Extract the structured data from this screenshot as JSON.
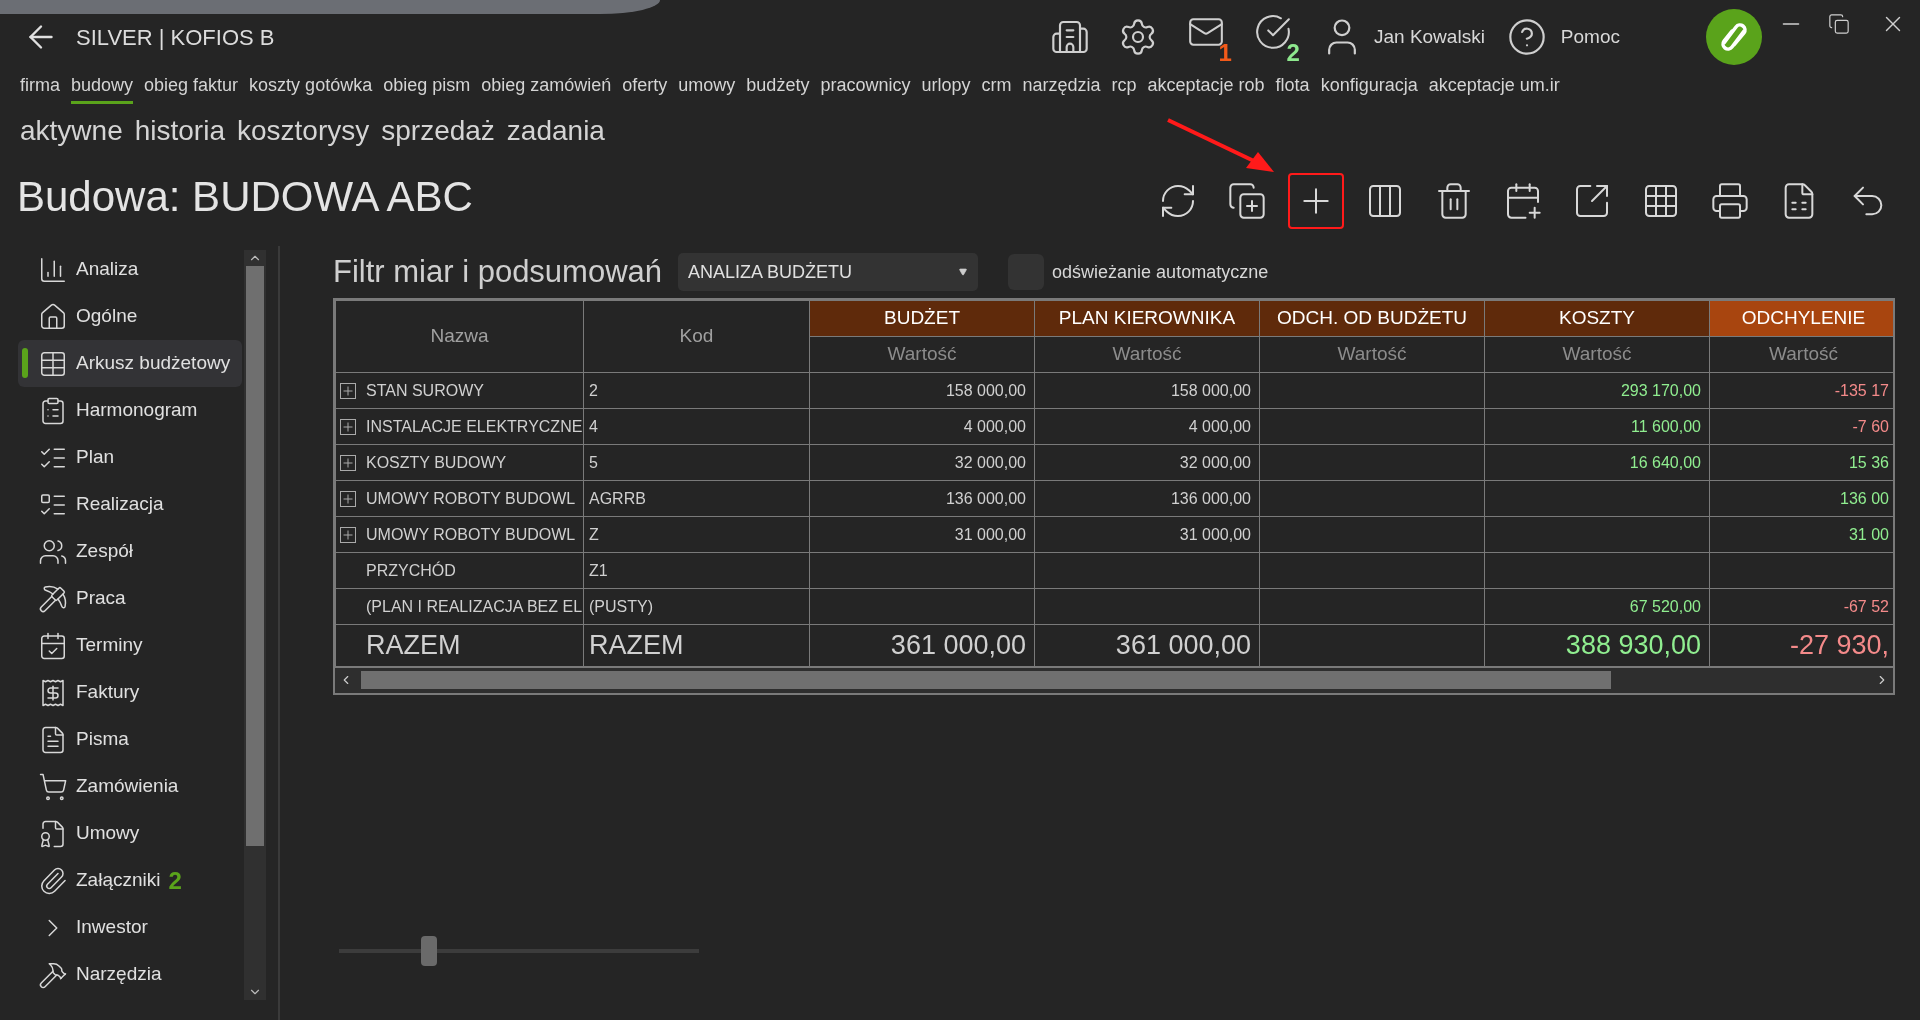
{
  "header": {
    "title": "SILVER | KOFIOS B",
    "mail_badge": {
      "text": "1",
      "color": "#f25a1a"
    },
    "tasks_badge": {
      "text": "2",
      "color": "#8ee88e"
    },
    "user": "Jan Kowalski",
    "help": "Pomoc"
  },
  "menu": [
    {
      "label": "firma",
      "selected": false
    },
    {
      "label": "budowy",
      "selected": true
    },
    {
      "label": "obieg faktur",
      "selected": false
    },
    {
      "label": "koszty gotówka",
      "selected": false
    },
    {
      "label": "obieg pism",
      "selected": false
    },
    {
      "label": "obieg zamówień",
      "selected": false
    },
    {
      "label": "oferty",
      "selected": false
    },
    {
      "label": "umowy",
      "selected": false
    },
    {
      "label": "budżety",
      "selected": false
    },
    {
      "label": "pracownicy",
      "selected": false
    },
    {
      "label": "urlopy",
      "selected": false
    },
    {
      "label": "crm",
      "selected": false
    },
    {
      "label": "narzędzia",
      "selected": false
    },
    {
      "label": "rcp",
      "selected": false
    },
    {
      "label": "akceptacje rob",
      "selected": false
    },
    {
      "label": "flota",
      "selected": false
    },
    {
      "label": "konfiguracja",
      "selected": false
    },
    {
      "label": "akceptacje um.ir",
      "selected": false
    }
  ],
  "subnav": [
    "aktywne",
    "historia",
    "kosztorysy",
    "sprzedaż",
    "zadania"
  ],
  "page_title": "Budowa: BUDOWA ABC",
  "toolbar": [
    {
      "highlighted": false
    },
    {
      "highlighted": false
    },
    {
      "highlighted": true
    },
    {
      "highlighted": false
    },
    {
      "highlighted": false
    },
    {
      "highlighted": false
    },
    {
      "highlighted": false
    },
    {
      "highlighted": false
    },
    {
      "highlighted": false
    },
    {
      "highlighted": false
    },
    {
      "highlighted": false
    }
  ],
  "sidebar": {
    "items": [
      {
        "label": "Analiza",
        "selected": false
      },
      {
        "label": "Ogólne",
        "selected": false
      },
      {
        "label": "Arkusz budżetowy",
        "selected": true
      },
      {
        "label": "Harmonogram",
        "selected": false
      },
      {
        "label": "Plan",
        "selected": false
      },
      {
        "label": "Realizacja",
        "selected": false
      },
      {
        "label": "Zespół",
        "selected": false
      },
      {
        "label": "Praca",
        "selected": false
      },
      {
        "label": "Terminy",
        "selected": false
      },
      {
        "label": "Faktury",
        "selected": false
      },
      {
        "label": "Pisma",
        "selected": false
      },
      {
        "label": "Zamówienia",
        "selected": false
      },
      {
        "label": "Umowy",
        "selected": false
      },
      {
        "label": "Załączniki",
        "selected": false,
        "badge": "2"
      },
      {
        "label": "Inwestor",
        "selected": false
      },
      {
        "label": "Narzędzia",
        "selected": false
      }
    ]
  },
  "filter": {
    "label": "Filtr miar i podsumowań",
    "dropdown": "ANALIZA BUDŻETU",
    "auto_refresh": {
      "label": "odświeżanie automatyczne",
      "checked": false
    }
  },
  "table": {
    "columns": [
      "Nazwa",
      "Kod"
    ],
    "groups": [
      {
        "label": "BUDŻET",
        "sub": "Wartość",
        "color": "#5f2a0b"
      },
      {
        "label": "PLAN KIEROWNIKA",
        "sub": "Wartość",
        "color": "#5f2a0b"
      },
      {
        "label": "ODCH. OD BUDŻETU",
        "sub": "Wartość",
        "color": "#5f2a0b"
      },
      {
        "label": "KOSZTY",
        "sub": "Wartość",
        "color": "#5f2a0b"
      },
      {
        "label": "ODCHYLENIE",
        "sub": "Wartość",
        "color": "#a8450f"
      }
    ],
    "rows": [
      {
        "name": "STAN SUROWY",
        "code": "2",
        "expandable": true,
        "cells": [
          {
            "text": "158 000,00",
            "color": "#d0d0d0"
          },
          {
            "text": "158 000,00",
            "color": "#d0d0d0"
          },
          null,
          {
            "text": "293 170,00",
            "color": "#90ee90"
          },
          {
            "text": "-135 17",
            "color": "#f48a8a"
          }
        ]
      },
      {
        "name": "INSTALACJE ELEKTRYCZNE",
        "code": "4",
        "expandable": true,
        "cells": [
          {
            "text": "4 000,00",
            "color": "#d0d0d0"
          },
          {
            "text": "4 000,00",
            "color": "#d0d0d0"
          },
          null,
          {
            "text": "11 600,00",
            "color": "#90ee90"
          },
          {
            "text": "-7 60",
            "color": "#f48a8a"
          }
        ]
      },
      {
        "name": "KOSZTY BUDOWY",
        "code": "5",
        "expandable": true,
        "cells": [
          {
            "text": "32 000,00",
            "color": "#d0d0d0"
          },
          {
            "text": "32 000,00",
            "color": "#d0d0d0"
          },
          null,
          {
            "text": "16 640,00",
            "color": "#90ee90"
          },
          {
            "text": "15 36",
            "color": "#90ee90"
          }
        ]
      },
      {
        "name": "UMOWY ROBOTY BUDOWL",
        "code": "AGRRB",
        "expandable": true,
        "cells": [
          {
            "text": "136 000,00",
            "color": "#d0d0d0"
          },
          {
            "text": "136 000,00",
            "color": "#d0d0d0"
          },
          null,
          null,
          {
            "text": "136 00",
            "color": "#90ee90"
          }
        ]
      },
      {
        "name": "UMOWY ROBOTY BUDOWL",
        "code": "Z",
        "expandable": true,
        "cells": [
          {
            "text": "31 000,00",
            "color": "#d0d0d0"
          },
          {
            "text": "31 000,00",
            "color": "#d0d0d0"
          },
          null,
          null,
          {
            "text": "31 00",
            "color": "#90ee90"
          }
        ]
      },
      {
        "name": "PRZYCHÓD",
        "code": "Z1",
        "expandable": false,
        "cells": [
          null,
          null,
          null,
          null,
          null
        ]
      },
      {
        "name": "(PLAN I REALIZACJA BEZ EL",
        "code": "(PUSTY)",
        "expandable": false,
        "cells": [
          null,
          null,
          null,
          {
            "text": "67 520,00",
            "color": "#90ee90"
          },
          {
            "text": "-67 52",
            "color": "#f48a8a"
          }
        ]
      }
    ],
    "total": {
      "name": "RAZEM",
      "code": "RAZEM",
      "cells": [
        {
          "text": "361 000,00",
          "color": "#d0d0d0"
        },
        {
          "text": "361 000,00",
          "color": "#d0d0d0"
        },
        null,
        {
          "text": "388 930,00",
          "color": "#90ee90"
        },
        {
          "text": "-27 930,",
          "color": "#f48a8a"
        }
      ]
    }
  },
  "zoom_slider": {
    "level": 0.25
  }
}
